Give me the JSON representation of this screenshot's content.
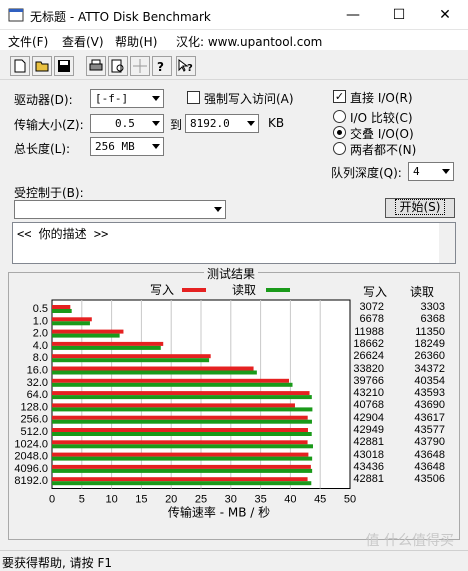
{
  "window": {
    "title": "无标题 - ATTO Disk Benchmark"
  },
  "menu": {
    "file": "文件(F)",
    "view": "查看(V)",
    "help": "帮助(H)",
    "localize": "汉化: www.upantool.com"
  },
  "form": {
    "drive_label": "驱动器(D):",
    "drive_value": "[-f-]",
    "transfer_label": "传输大小(Z):",
    "transfer_from": "0.5",
    "to_label": "到",
    "transfer_to": "8192.0",
    "kb_unit": "KB",
    "length_label": "总长度(L):",
    "length_value": "256 MB",
    "force_write_label": "强制写入访问(A)",
    "direct_io_label": "直接 I/O(R)",
    "io_compare_label": "I/O 比较(C)",
    "overlap_io_label": "交叠 I/O(O)",
    "neither_label": "两者都不(N)",
    "queue_label": "队列深度(Q):",
    "queue_value": "4",
    "controlled_by_label": "受控制于(B):",
    "start_label": "开始(S)",
    "description": "<<  你的描述  >>"
  },
  "results": {
    "title": "测试结果",
    "legend_write": "写入",
    "legend_read": "读取",
    "col_write": "写入",
    "col_read": "读取",
    "xlabel": "传输速率 - MB / 秒"
  },
  "colors": {
    "write": "#e52121",
    "read": "#1a9a1a"
  },
  "status": {
    "text": "要获得帮助, 请按 F1"
  },
  "watermark": "值 什么值得买",
  "chart_data": {
    "type": "bar",
    "categories": [
      "0.5",
      "1.0",
      "2.0",
      "4.0",
      "8.0",
      "16.0",
      "32.0",
      "64.0",
      "128.0",
      "256.0",
      "512.0",
      "1024.0",
      "2048.0",
      "4096.0",
      "8192.0"
    ],
    "series": [
      {
        "name": "写入",
        "values": [
          3072,
          6678,
          11988,
          18662,
          26624,
          33820,
          39766,
          43210,
          40768,
          42904,
          42949,
          42881,
          43018,
          43436,
          42881
        ]
      },
      {
        "name": "读取",
        "values": [
          3303,
          6368,
          11350,
          18249,
          26360,
          34372,
          40354,
          43593,
          43690,
          43617,
          43577,
          43790,
          43648,
          43648,
          43506
        ]
      }
    ],
    "xticks": [
      "0",
      "5",
      "10",
      "15",
      "20",
      "25",
      "30",
      "35",
      "40",
      "45",
      "50"
    ],
    "xlim": [
      0,
      50
    ],
    "xlabel": "传输速率 - MB / 秒",
    "orientation": "horizontal",
    "grid": true
  }
}
